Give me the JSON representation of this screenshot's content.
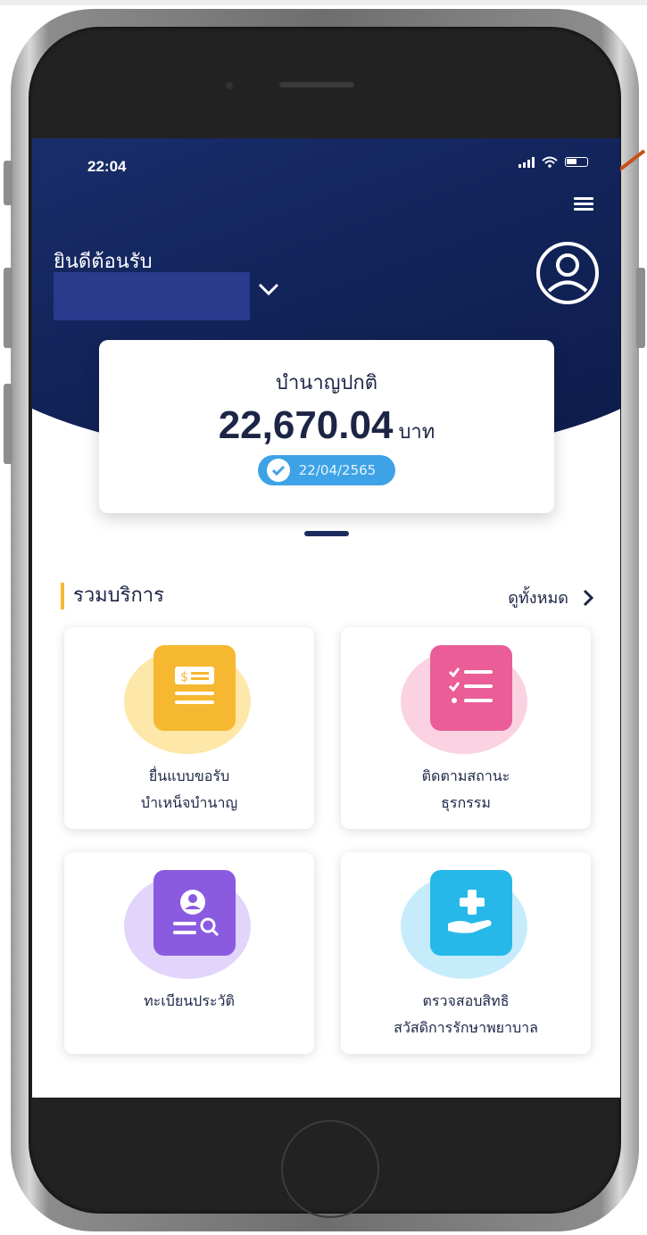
{
  "status_bar": {
    "time": "22:04"
  },
  "header": {
    "welcome": "ยินดีต้อนรับ"
  },
  "balance": {
    "label": "บำนาญปกติ",
    "amount": "22,670.04",
    "unit": "บาท",
    "date": "22/04/2565"
  },
  "services": {
    "title": "รวมบริการ",
    "see_all": "ดูทั้งหมด",
    "items": [
      {
        "line1": "ยื่นแบบขอรับ",
        "line2": "บำเหน็จบำนาญ",
        "icon": "money-document-icon",
        "color": "#f6b830"
      },
      {
        "line1": "ติดตามสถานะ",
        "line2": "ธุรกรรม",
        "icon": "checklist-icon",
        "color": "#ea5d97"
      },
      {
        "line1": "ทะเบียนประวัติ",
        "line2": "",
        "icon": "profile-search-icon",
        "color": "#8a5be0"
      },
      {
        "line1": "ตรวจสอบสิทธิ",
        "line2": "สวัสดิการรักษาพยาบาล",
        "icon": "medical-care-icon",
        "color": "#27b8ea"
      }
    ]
  },
  "colors": {
    "header_navy": "#12245a",
    "accent_yellow": "#f5b931",
    "pill_blue": "#3ea3e6"
  }
}
